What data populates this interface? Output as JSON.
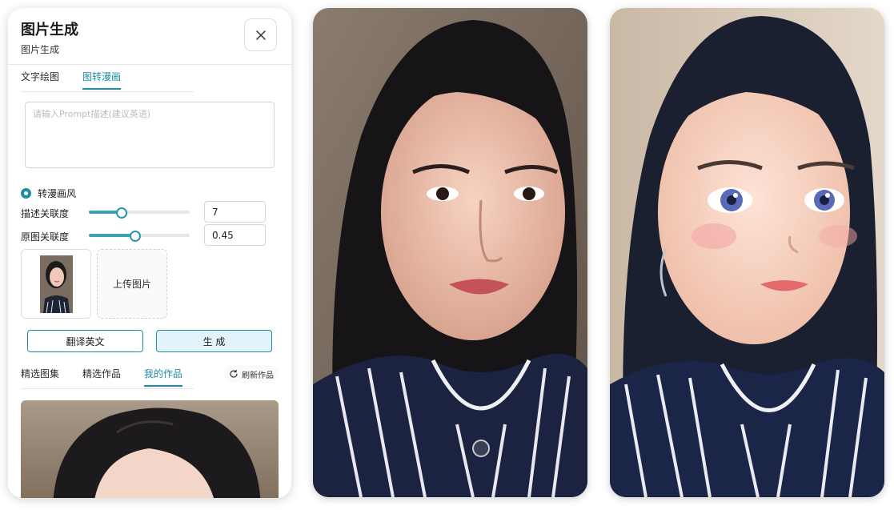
{
  "panel": {
    "title": "图片生成",
    "subtitle": "图片生成",
    "close_icon": "close-icon",
    "tabs": [
      {
        "label": "文字绘图",
        "active": false
      },
      {
        "label": "图转漫画",
        "active": true
      }
    ],
    "prompt": {
      "placeholder": "请输入Prompt描述(建议英语)",
      "value": ""
    },
    "style_option": {
      "label": "转漫画风",
      "selected": true
    },
    "sliders": [
      {
        "label": "描述关联度",
        "value": "7",
        "fraction": 0.32
      },
      {
        "label": "原图关联度",
        "value": "0.45",
        "fraction": 0.45
      }
    ],
    "upload_label": "上传图片",
    "translate_button": "翻译英文",
    "generate_button": "生 成",
    "gallery_tabs": [
      {
        "label": "精选图集",
        "active": false
      },
      {
        "label": "精选作品",
        "active": false
      },
      {
        "label": "我的作品",
        "active": true
      }
    ],
    "refresh_label": "刷新作品",
    "refresh_icon": "refresh-icon"
  },
  "colors": {
    "accent": "#1f8ea3",
    "generate_bg": "#e3f3fa",
    "border": "#d3d6da"
  }
}
